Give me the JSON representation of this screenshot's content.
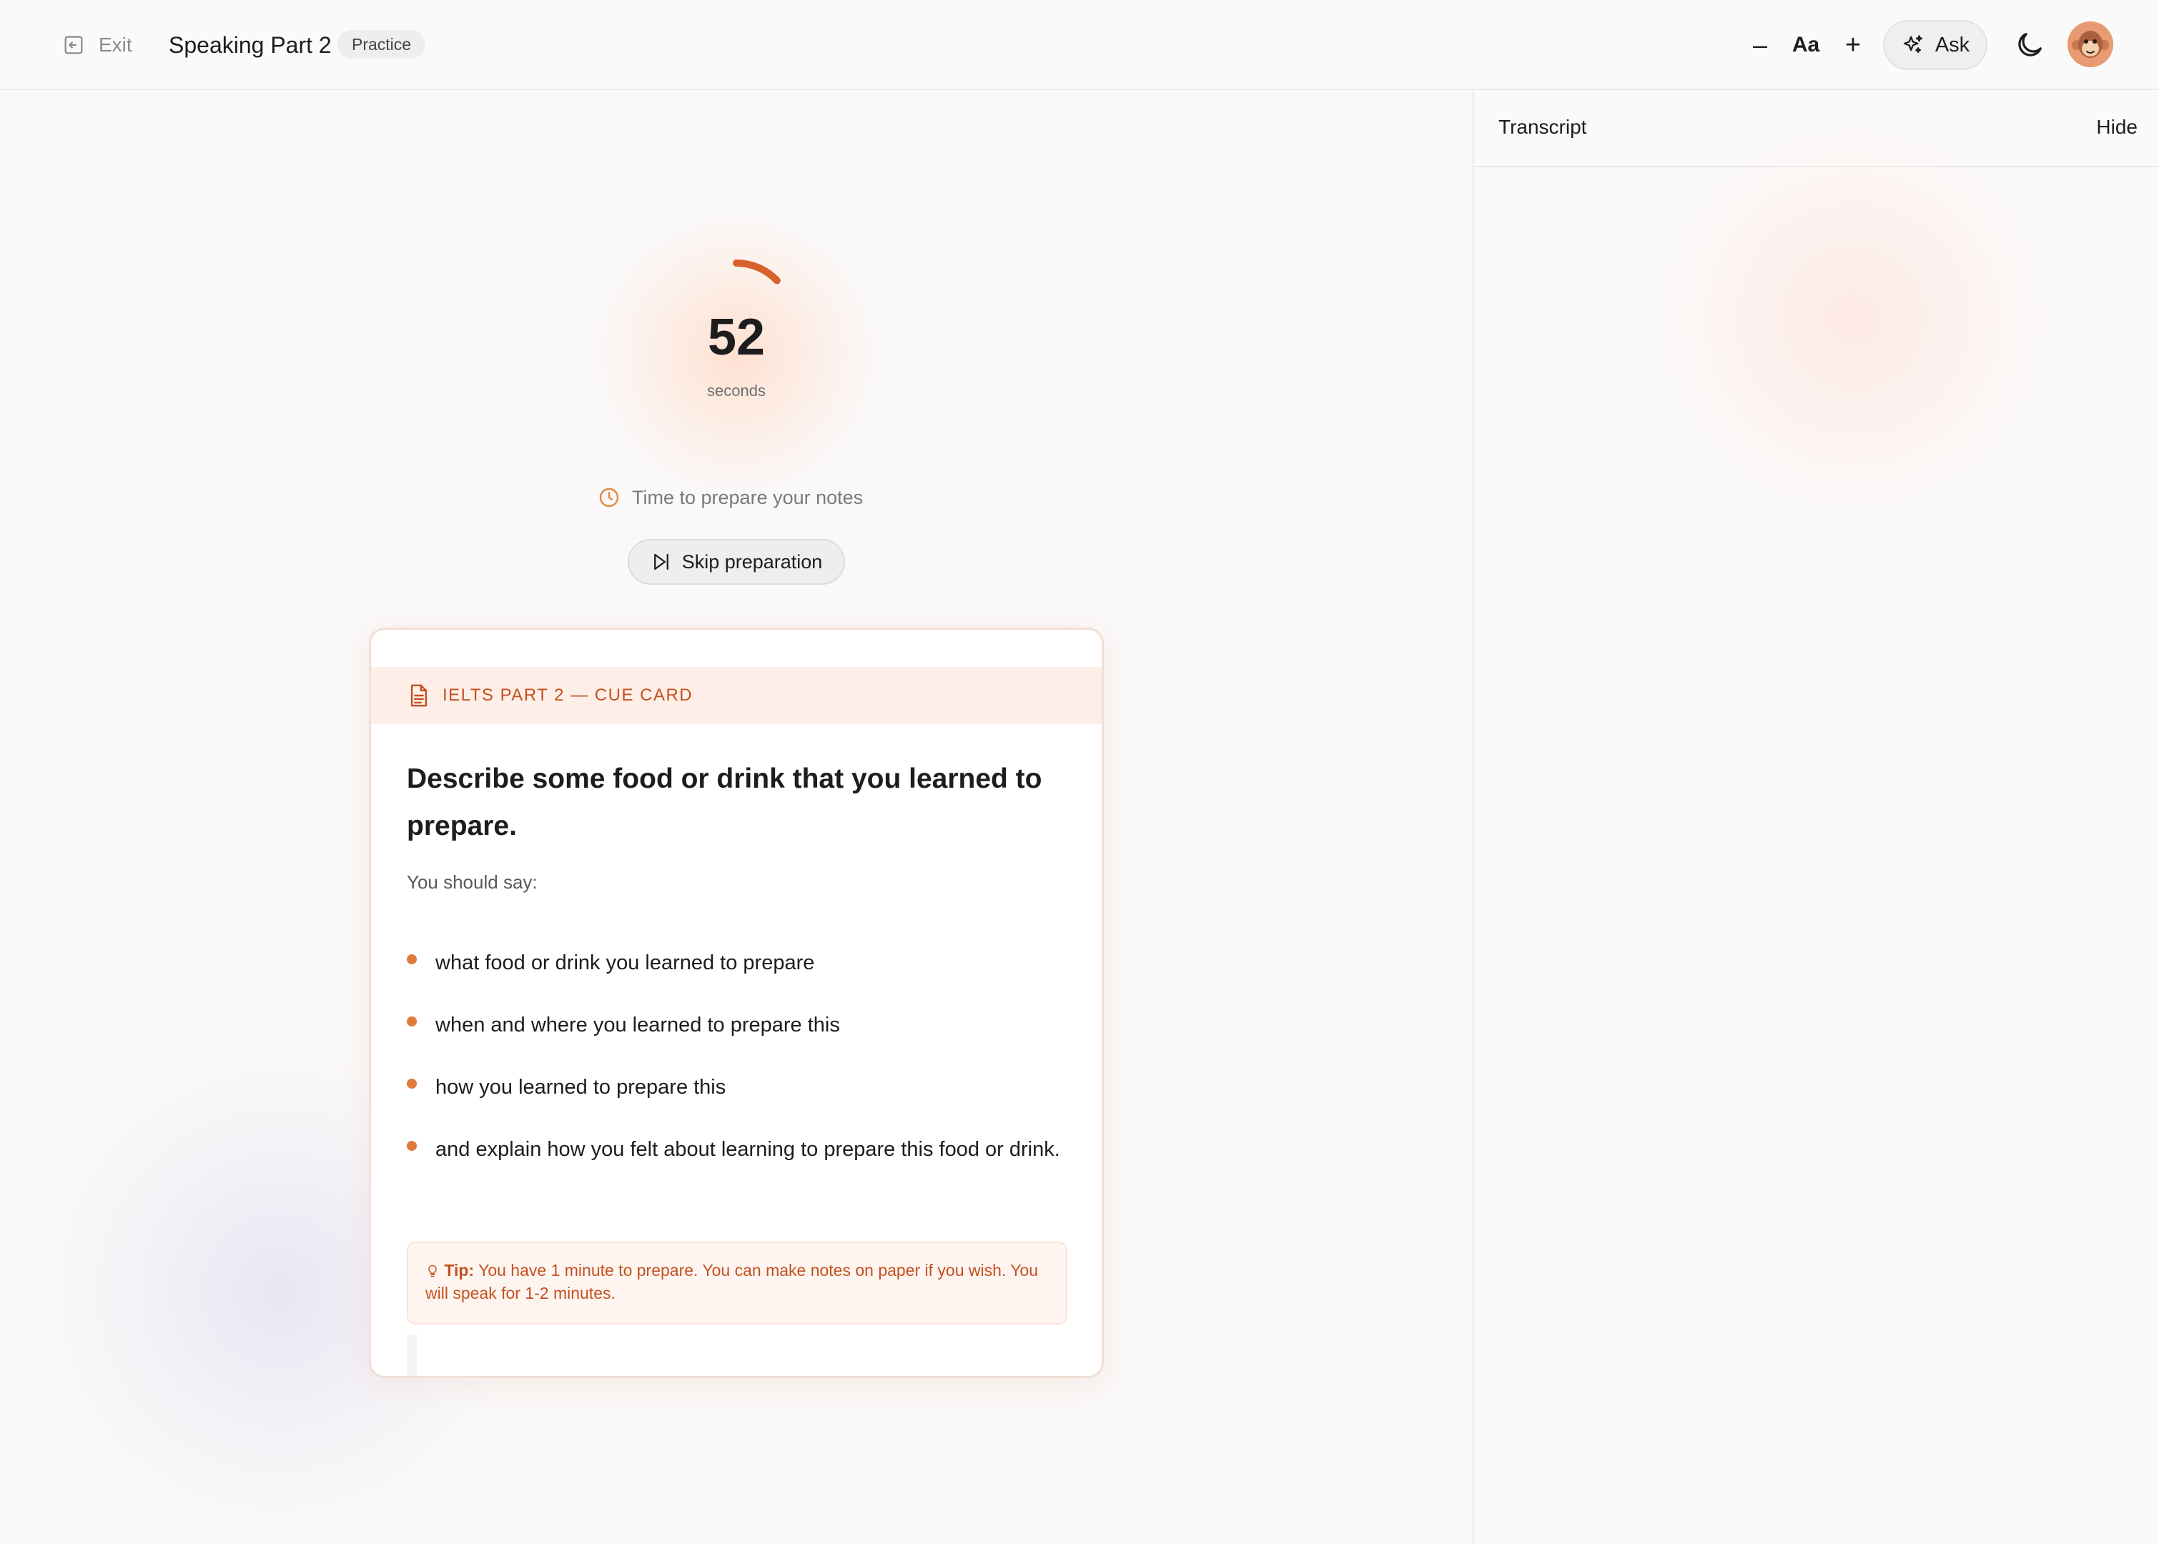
{
  "header": {
    "exit_label": "Exit",
    "title": "Speaking Part 2",
    "mode_badge": "Practice",
    "font_decrease": "–",
    "font_label": "Aa",
    "font_increase": "+",
    "ask_label": "Ask"
  },
  "timer": {
    "value": "52",
    "unit": "seconds",
    "progress_fraction": 0.13,
    "prep_note": "Time to prepare your notes",
    "skip_label": "Skip preparation"
  },
  "cue_card": {
    "header_label": "IELTS PART 2 — CUE CARD",
    "question": "Describe some food or drink that you learned to prepare.",
    "intro": "You should say:",
    "points": [
      "what food or drink you learned to prepare",
      "when and where you learned to prepare this",
      "how you learned to prepare this",
      "and explain how you felt about learning to prepare this food or drink."
    ],
    "tip_label": "Tip:",
    "tip_text": "You have 1 minute to prepare. You can make notes on paper if you wish. You will speak for 1-2 minutes."
  },
  "transcript": {
    "title": "Transcript",
    "hide_label": "Hide"
  },
  "colors": {
    "accent": "#d9602a",
    "accent_soft": "#fdefe8",
    "bullet": "#e07b3e"
  },
  "icons": {
    "exit": "exit-icon",
    "ask": "sparkle-icon",
    "theme": "moon-icon",
    "clock": "clock-icon",
    "skip": "skip-icon",
    "card": "document-icon",
    "tip": "lightbulb-icon"
  }
}
